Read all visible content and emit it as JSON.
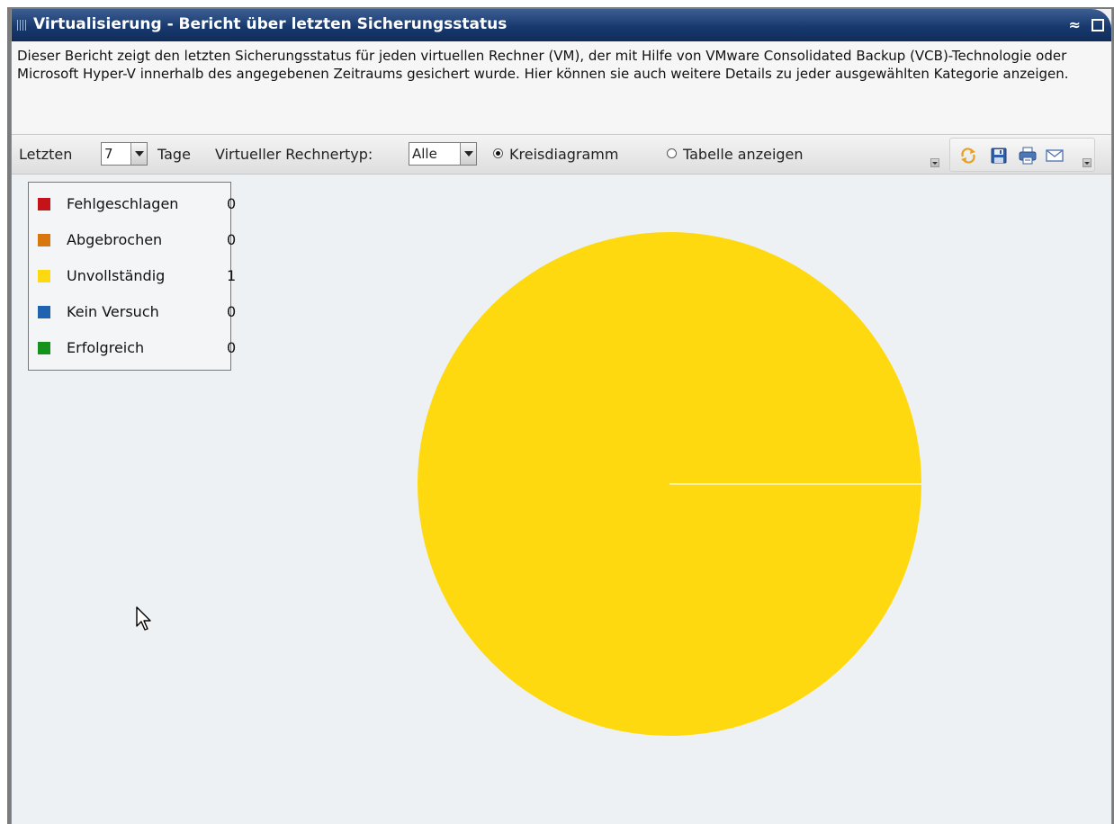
{
  "window": {
    "title": "Virtualisierung - Bericht über letzten Sicherungsstatus",
    "collapse_glyph": "≈"
  },
  "description": "Dieser Bericht zeigt den letzten Sicherungsstatus für jeden virtuellen Rechner (VM), der mit Hilfe von VMware Consolidated Backup (VCB)-Technologie oder Microsoft Hyper-V innerhalb des angegebenen Zeitraums gesichert wurde. Hier können sie auch weitere Details zu jeder ausgewählten Kategorie anzeigen.",
  "toolbar": {
    "last_label": "Letzten",
    "days_value": "7",
    "days_label": "Tage",
    "vm_type_label": "Virtueller Rechnertyp:",
    "vm_type_value": "Alle",
    "pie_option": "Kreisdiagramm",
    "table_option": "Tabelle anzeigen",
    "selected_view": "Kreisdiagramm",
    "icons": [
      "refresh-icon",
      "save-icon",
      "print-icon",
      "email-icon"
    ]
  },
  "chart_data": {
    "type": "pie",
    "categories": [
      "Fehlgeschlagen",
      "Abgebrochen",
      "Unvollständig",
      "Kein Versuch",
      "Erfolgreich"
    ],
    "values": [
      0,
      0,
      1,
      0,
      0
    ],
    "colors": [
      "#c4141a",
      "#d9770f",
      "#ffd90f",
      "#1f63b0",
      "#15921c"
    ],
    "legend_position": "top-left"
  },
  "colors": {
    "title_bar": "#18396e",
    "chart_background": "#eef1f4"
  }
}
